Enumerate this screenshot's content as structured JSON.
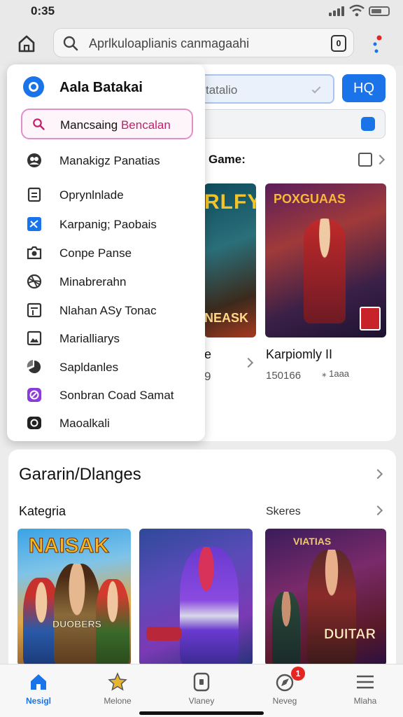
{
  "status_bar": {
    "time": "0:35"
  },
  "top_bar": {
    "search_text": "Aprlkuloaplianis canmagaahi",
    "tab_count": "0"
  },
  "colors": {
    "accent": "#1a73e8",
    "badge_red": "#e52424",
    "drawer_search_border": "#e090c8"
  },
  "main": {
    "field_placeholder": "tatalio",
    "hq_button": "HQ",
    "games_label": "Game:",
    "left_card": {
      "title": "RLFY",
      "subtitle": "NEASK",
      "name": "e",
      "meta": "9"
    },
    "right_card": {
      "title": "POXGUAAS",
      "name": "Karpiomly II",
      "meta": "150166",
      "rating": "⁎ 1aaa"
    }
  },
  "drawer": {
    "title": "Aala Batakai",
    "search_primary": "Mancsaing",
    "search_accent": "Bencalan",
    "items": [
      {
        "label": "Manakigz Panatias",
        "icon": "users-icon"
      },
      {
        "label": "Oprynlnlade",
        "icon": "document-icon"
      },
      {
        "label": "Karpanig; Paobais",
        "icon": "checkbox-icon"
      },
      {
        "label": "Conpe Panse",
        "icon": "camera-icon"
      },
      {
        "label": "Minabrerahn",
        "icon": "globe-icon"
      },
      {
        "label": "Nlahan ASy Tonac",
        "icon": "form-icon"
      },
      {
        "label": "Marialliarys",
        "icon": "image-icon"
      },
      {
        "label": "Sapldanles",
        "icon": "pie-chart-icon"
      },
      {
        "label": "Sonbran Coad Samat",
        "icon": "circle-link-icon"
      },
      {
        "label": "Maoalkali",
        "icon": "camera-lens-icon"
      }
    ]
  },
  "section2": {
    "title": "Gararin/Dlanges",
    "sub_left": "Kategria",
    "sub_right": "Skeres",
    "cards": [
      {
        "title": "NAISAK",
        "subtitle": "DUOBERS"
      },
      {
        "title": "",
        "subtitle": ""
      },
      {
        "title": "VIATIAS",
        "subtitle": "DUITAR"
      }
    ]
  },
  "bottom_nav": [
    {
      "label": "Nesigl",
      "icon": "home-icon",
      "active": true
    },
    {
      "label": "Melone",
      "icon": "star-icon",
      "active": false
    },
    {
      "label": "Vlaney",
      "icon": "phone-icon",
      "active": false
    },
    {
      "label": "Neveg",
      "icon": "compass-icon",
      "active": false,
      "badge": "1"
    },
    {
      "label": "Mlaha",
      "icon": "menu-icon",
      "active": false
    }
  ]
}
